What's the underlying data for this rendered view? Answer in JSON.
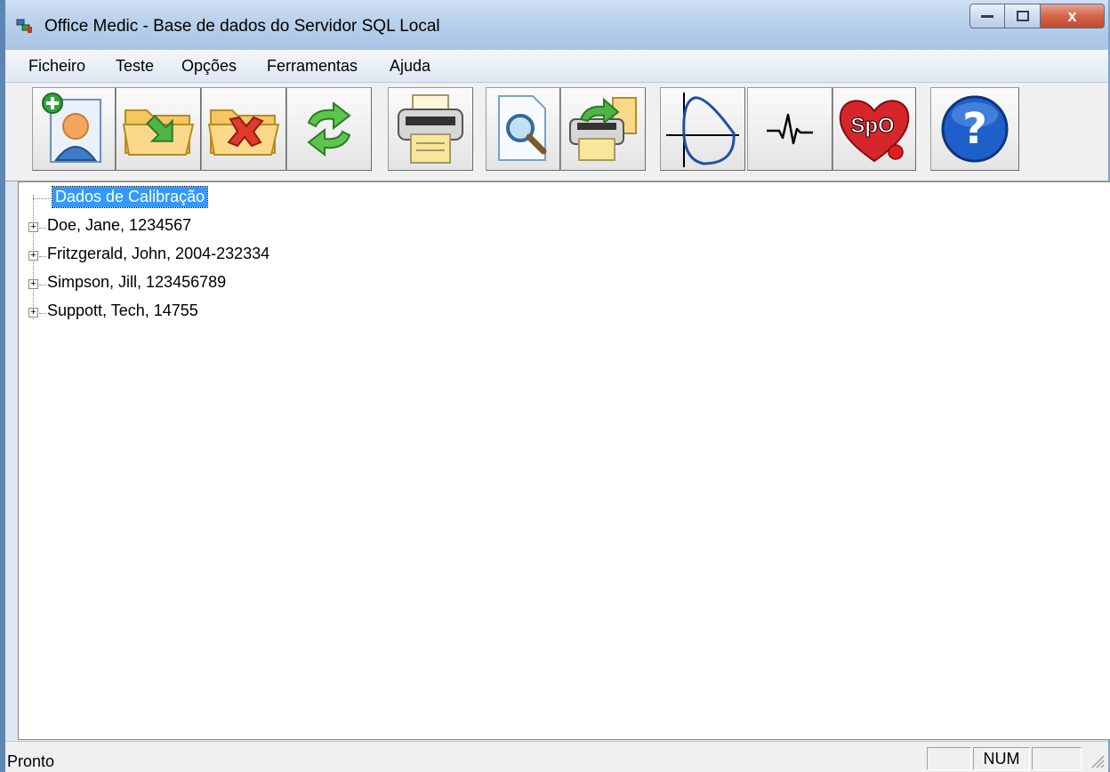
{
  "window": {
    "title": "Office Medic - Base de dados do Servidor SQL Local",
    "app_icon": "app-icon",
    "controls": {
      "minimize_icon": "minimize-icon",
      "maximize_icon": "maximize-icon",
      "close_label": "x"
    }
  },
  "menu": {
    "items": [
      {
        "label": "Ficheiro"
      },
      {
        "label": "Teste"
      },
      {
        "label": "Opções"
      },
      {
        "label": "Ferramentas"
      },
      {
        "label": "Ajuda"
      }
    ]
  },
  "toolbar": {
    "buttons": [
      {
        "icon": "new-patient-icon"
      },
      {
        "icon": "open-folder-icon"
      },
      {
        "icon": "delete-folder-icon"
      },
      {
        "icon": "refresh-icon"
      },
      {
        "icon": "printer-icon"
      },
      {
        "icon": "print-preview-icon"
      },
      {
        "icon": "export-icon"
      },
      {
        "icon": "flow-volume-curve-icon"
      },
      {
        "icon": "ecg-icon"
      },
      {
        "icon": "spo2-heart-icon",
        "text": "SpO"
      },
      {
        "icon": "help-icon",
        "text": "?"
      }
    ]
  },
  "tree": {
    "root": {
      "label": "Dados de Calibração",
      "selected": true
    },
    "items": [
      {
        "label": "Doe, Jane, 1234567"
      },
      {
        "label": "Fritzgerald, John, 2004-232334"
      },
      {
        "label": "Simpson, Jill, 123456789"
      },
      {
        "label": "Suppott, Tech, 14755"
      }
    ],
    "expander_symbol": "+"
  },
  "status": {
    "text": "Pronto",
    "panes": [
      "",
      "NUM",
      ""
    ]
  },
  "colors": {
    "selection": "#3399ff",
    "titlebar": "#b8d0ea",
    "close_button": "#c0472b"
  }
}
